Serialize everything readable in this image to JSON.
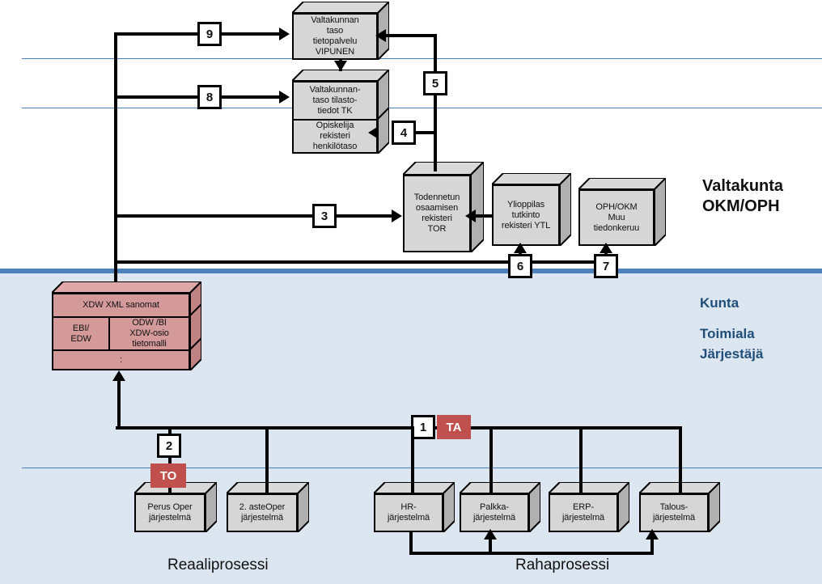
{
  "zones": {
    "upper_label_line1": "Valtakunta",
    "upper_label_line2": "OKM/OPH",
    "lower_label_line1": "Kunta",
    "lower_label_line2": "Toimiala",
    "lower_label_line3": "Järjestäjä",
    "divider_color": "#4f81bd",
    "lower_background": "#dce6f1",
    "guide_line_color": "#4a7ebb"
  },
  "process_labels": {
    "real": "Reaaliprosessi",
    "money": "Rahaprosessi"
  },
  "national_systems": {
    "vipunen": {
      "l1": "Valtakunnan",
      "l2": "taso",
      "l3": "tietopalvelu",
      "l4": "VIPUNEN"
    },
    "tk": {
      "l1": "Valtakunnan-",
      "l2": "taso tilasto-",
      "l3": "tiedot TK"
    },
    "opiskelija": {
      "l1": "Opiskelija",
      "l2": "rekisteri",
      "l3": "henkilötaso"
    },
    "tor": {
      "l1": "Todennetun",
      "l2": "osaamisen",
      "l3": "rekisteri",
      "l4": "TOR"
    },
    "ytl": {
      "l1": "Ylioppilas",
      "l2": "tutkinto",
      "l3": "rekisteri YTL"
    },
    "muu": {
      "l1": "OPH/OKM",
      "l2": "Muu",
      "l3": "tiedonkeruu"
    }
  },
  "warehouse": {
    "header": "XDW XML sanomat",
    "left_cell_l1": "EBI/",
    "left_cell_l2": "EDW",
    "right_cell_l1": "ODW  /BI",
    "right_cell_l2": "XDW-osio",
    "right_cell_l3": "tietomalli",
    "footer": ":",
    "color": "#d49a9a"
  },
  "source_systems": {
    "perus": {
      "l1": "Perus Oper",
      "l2": "järjestelmä"
    },
    "aste2": {
      "l1": "2. asteOper",
      "l2": "järjestelmä"
    },
    "hr": {
      "l1": "HR-",
      "l2": "järjestelmä"
    },
    "palkka": {
      "l1": "Palkka-",
      "l2": "järjestelmä"
    },
    "erp": {
      "l1": "ERP-",
      "l2": "järjestelmä"
    },
    "talous": {
      "l1": "Talous-",
      "l2": "järjestelmä"
    }
  },
  "markers": {
    "n1": "1",
    "n2": "2",
    "n3": "3",
    "n4": "4",
    "n5": "5",
    "n6": "6",
    "n7": "7",
    "n8": "8",
    "n9": "9",
    "ta": "TA",
    "to": "TO",
    "badge_color": "#c0504d"
  }
}
